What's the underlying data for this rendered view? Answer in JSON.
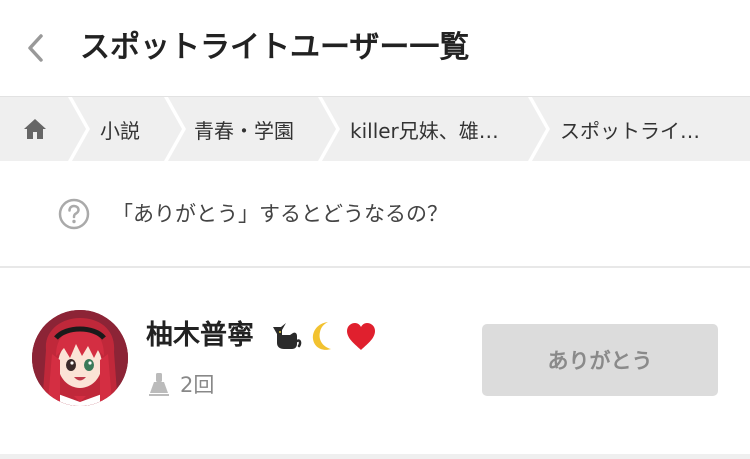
{
  "header": {
    "title": "スポットライトユーザー一覧"
  },
  "breadcrumb": {
    "items": [
      {
        "label": "小説"
      },
      {
        "label": "青春・学園"
      },
      {
        "label": "killer兄妹、雄…"
      },
      {
        "label": "スポットライ…"
      }
    ]
  },
  "help": {
    "text": "「ありがとう」するとどうなるの？"
  },
  "users": [
    {
      "name": "柚木普寧",
      "name_emoji": [
        "black-cat",
        "crescent-moon",
        "red-heart"
      ],
      "count": "2回",
      "button_label": "ありがとう"
    }
  ],
  "colors": {
    "breadcrumb_bg": "#efefef",
    "button_bg": "#dcdcdc",
    "button_text": "#8a8a8a",
    "muted_text": "#888888"
  }
}
